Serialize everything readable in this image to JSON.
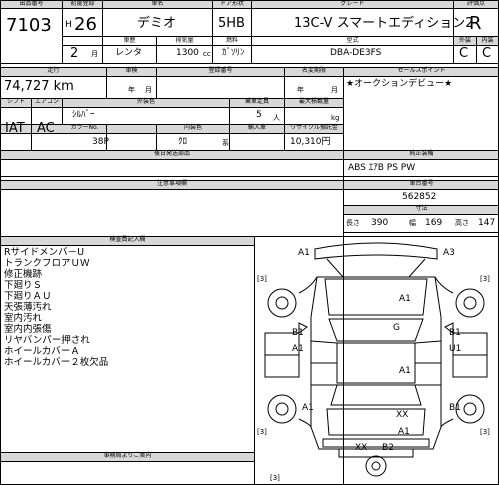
{
  "header": {
    "lot_label": "出品番号",
    "lot_no": "7103",
    "first_reg_label": "初度登録",
    "era": "H",
    "year": "26",
    "month": "2",
    "month_unit": "月",
    "car_name_label": "車名",
    "car_name": "デミオ",
    "door_label": "ドア形状",
    "door": "5HB",
    "grade_label": "グレード",
    "grade": "13C-V スマートエディション2",
    "rating_label": "評価点",
    "rating": "R",
    "usage": "レンタ",
    "displacement_label": "排気量",
    "displacement": "1300",
    "displacement_unit": "cc",
    "fuel": "ｶﾞｿﾘﾝ",
    "type_label": "型式",
    "model_code": "DBA-DE3FS",
    "ext_label": "外装",
    "int_label": "内装",
    "ext_grade": "C",
    "int_grade": "C",
    "vehicle_use_label": "車歴",
    "fuel_label": "燃料"
  },
  "specs": {
    "mileage_label": "走行",
    "mileage": "74,727 km",
    "inspection_label": "車検",
    "inspection_year_unit": "年",
    "inspection_month_unit": "月",
    "plate_label": "登録番号",
    "name_change_label": "名変期限",
    "name_change_year_unit": "年",
    "name_change_month_unit": "月",
    "shift_label": "シフト",
    "ac_label": "エアコン",
    "shift": "IAT",
    "ac": "AC",
    "ext_color_label": "外装色",
    "ext_color": "ｼﾙﾊﾞｰ",
    "capacity_label": "乗車定員",
    "capacity": "5",
    "capacity_unit": "人",
    "load_label": "最大積載量",
    "load_unit": "kg",
    "color_no_label": "カラーNo.",
    "color_no": "38P",
    "int_color_label": "内装色",
    "int_color": "ｸﾛ",
    "int_color_suffix": "系",
    "import_label": "輸入車",
    "recycle_label": "リサイクル預託金",
    "recycle": "10,310円",
    "retrofit_label": "後日発送部品"
  },
  "sales_point": {
    "label": "セールスポイント",
    "text": "★オークションデビュー★"
  },
  "equipment": {
    "label": "純正装備",
    "text": "ABS ｴｱB PS PW"
  },
  "chassis": {
    "label": "車台番号",
    "value": "562852"
  },
  "notes_label": "注意事項欄",
  "dimensions": {
    "label": "寸法",
    "length_label": "長さ",
    "length": "390",
    "width_label": "幅",
    "width": "169",
    "height_label": "高さ",
    "height": "147"
  },
  "inspector": {
    "label": "検査員記入欄",
    "remarks": [
      "Rサイドメンバ－U",
      "トランクフロアＵＷ",
      "修正機跡",
      "下廻りＳ",
      "下廻りＡＵ",
      "天張薄汚れ",
      "室内汚れ",
      "室内内張傷",
      "リヤバンパー押され",
      "ホイールカバーＡ",
      "ホイールカバー２枚欠品"
    ]
  },
  "office_label": "事務局よりご案内",
  "damage_map": {
    "marks": [
      "A1",
      "A3",
      "A1",
      "G",
      "B1",
      "B1",
      "A1",
      "U1",
      "A1",
      "B1",
      "XX",
      "XX",
      "B2",
      "A1",
      "A1",
      "[3]",
      "[3]",
      "[3]",
      "[3]",
      "[3]"
    ]
  },
  "colors": {
    "shade": "#d8d8d8",
    "line": "#000000"
  }
}
